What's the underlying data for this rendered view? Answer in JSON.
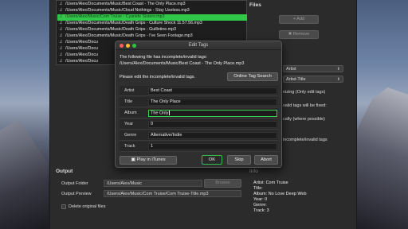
{
  "files": [
    "/Users/Alex/Documents/Music/Best Coast - The Only Place.mp3",
    "/Users/Alex/Documents/Music/Cloud Nothings - Stay Useless.mp3",
    "/Users/Alex/Music/Com Truise - Cyanide Sisters.mp3",
    "/Users/Alex/Documents/Music/Death Grips - Culture Shock 11.57.56.mp3",
    "/Users/Alex/Documents/Music/Death Grips - Guillotine.mp3",
    "/Users/Alex/Documents/Music/Death Grips - I've Seen Footage.mp3",
    "/Users/Alex/Docu",
    "/Users/Alex/Docu",
    "/Users/Alex/Docu",
    "/Users/Alex/Docu"
  ],
  "selected_index": 2,
  "files_panel": {
    "title": "Files",
    "add_label": "+ Add",
    "remove_label": "✖ Remove"
  },
  "tag_selects": {
    "first": "Artist",
    "second": "Artist-Title"
  },
  "tag_options": {
    "opt1": "nizing (Only edit tags)",
    "opt2": "valid tags will be fixed:",
    "opt3": "cally (where possible)",
    "opt4": "incomplete/invalid tags"
  },
  "output": {
    "section_title": "Output",
    "folder_label": "Output Folder",
    "folder_value": "/Users/Alex/Music",
    "browse_label": "Browse",
    "preview_label": "Output Preview",
    "preview_value": "/Users/Alex/Music/Com Truise/Com Truise-Title.mp3",
    "delete_label": "Delete original files"
  },
  "info": {
    "section_title": "Info",
    "artist": "Artist: Com Truise",
    "title": "Title:",
    "album": "Album: No Love Deep Web",
    "year": "Year: 0",
    "genre": "Genre:",
    "track": "Track: 3"
  },
  "dialog": {
    "title": "Edit Tags",
    "message1": "The following file has incomplete/invalid tags:",
    "message2": "/Users/Alex/Documents/Music/Best Coast - The Only Place.mp3",
    "instruction": "Please edit the incomplete/invalid tags.",
    "online_search_label": "Online Tag Search",
    "fields": [
      {
        "label": "Artist",
        "value": "Best Coast"
      },
      {
        "label": "Title",
        "value": "The Only Place"
      },
      {
        "label": "Album",
        "value": "The Only"
      },
      {
        "label": "Year",
        "value": "0"
      },
      {
        "label": "Genre",
        "value": "Alternative/Indie"
      },
      {
        "label": "Track",
        "value": "1"
      }
    ],
    "focused_field": "Album",
    "play_label": "Play in iTunes",
    "ok_label": "OK",
    "skip_label": "Skip",
    "abort_label": "Abort"
  },
  "colors": {
    "selection": "#31c84a",
    "ok_border": "#35c04b",
    "close": "#fc5f57",
    "minimize": "#fdbc2e",
    "zoom": "#28c840"
  }
}
